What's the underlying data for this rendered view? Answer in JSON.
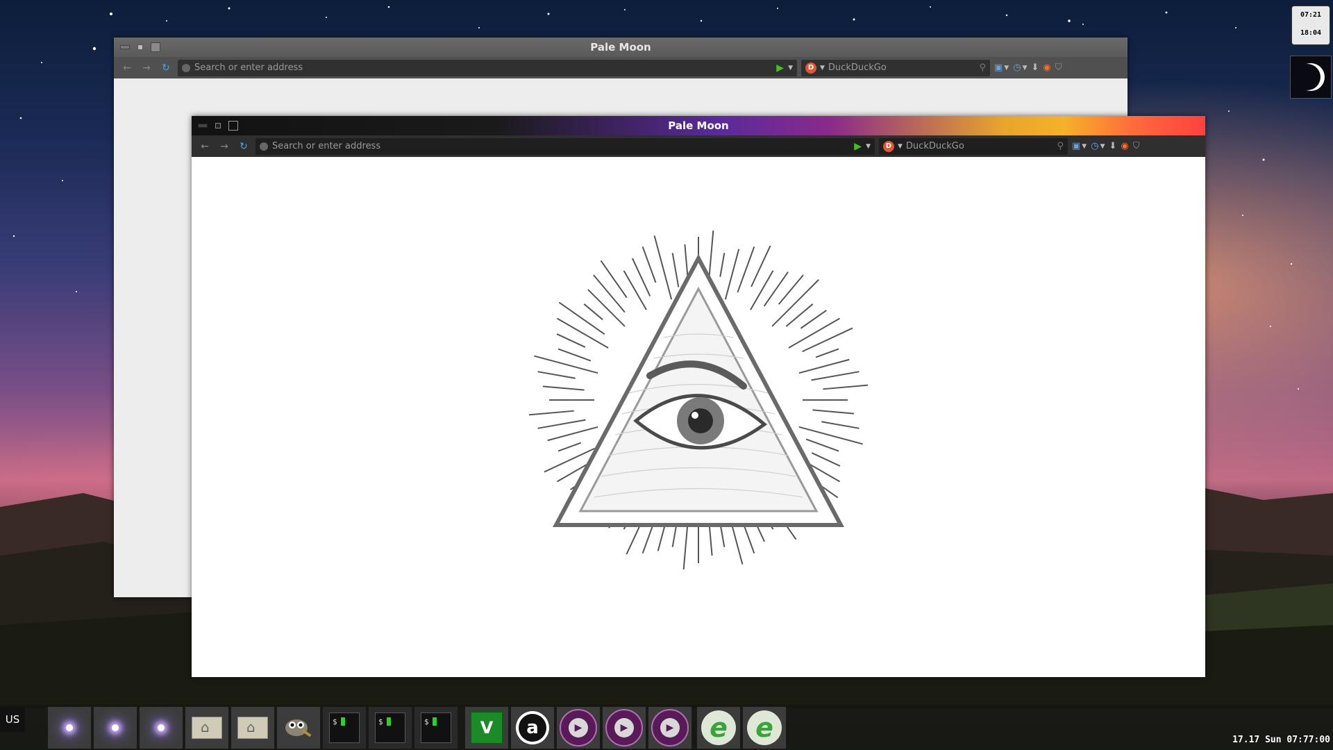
{
  "windows": {
    "back": {
      "title": "Pale Moon",
      "url_placeholder": "Search or enter address",
      "search_engine": "DuckDuckGo"
    },
    "front": {
      "title": "Pale Moon",
      "url_placeholder": "Search or enter address",
      "search_engine": "DuckDuckGo",
      "page_image": "eye-of-providence-illustration"
    }
  },
  "clock_widget": {
    "time1": "07:21",
    "time2": "18:04"
  },
  "taskbar": {
    "keyboard_layout": "US",
    "status_clock": "17.17 Sun 07:77:00",
    "items": [
      "stellarium",
      "stellarium",
      "stellarium",
      "home-folder",
      "home-folder",
      "gimp",
      "terminal",
      "terminal",
      "terminal",
      "vim",
      "audacity",
      "media-player",
      "media-player",
      "media-player",
      "e-app",
      "e-app"
    ]
  },
  "colors": {
    "accent_green": "#44c21c",
    "ddg_orange": "#de5833"
  }
}
